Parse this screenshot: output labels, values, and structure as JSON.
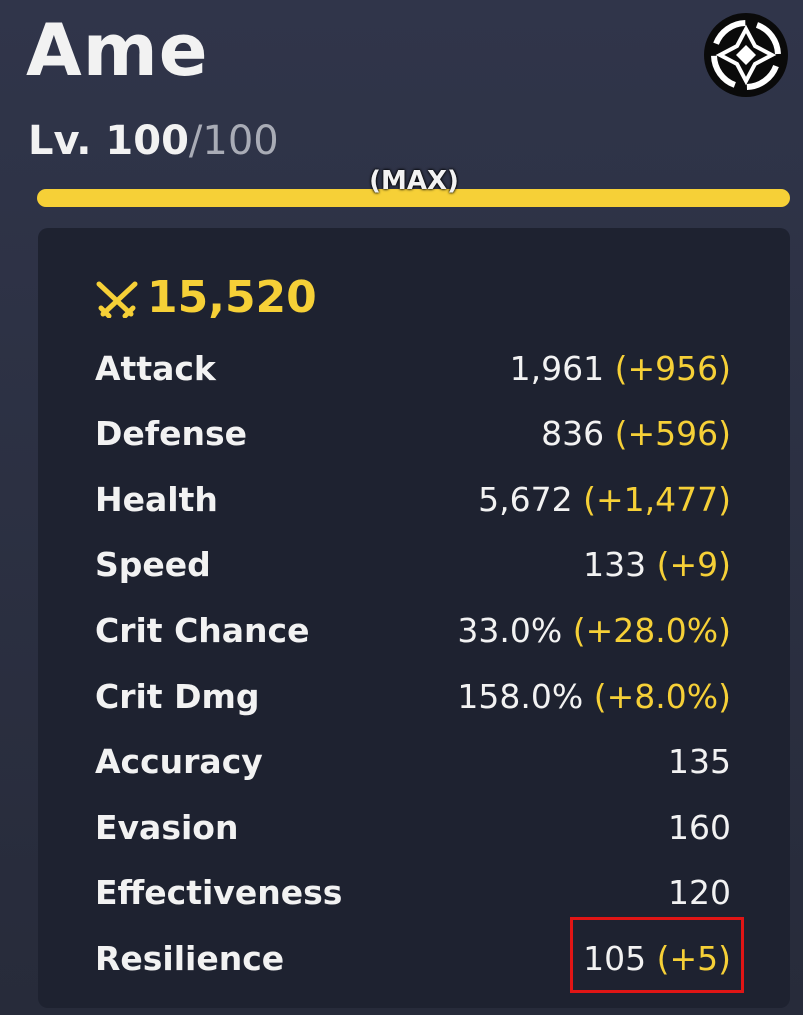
{
  "character": {
    "name": "Ame",
    "level_prefix": "Lv. ",
    "level": "100",
    "max_level": "/100",
    "level_progress": 1.0,
    "max_label": "(MAX)"
  },
  "power": {
    "icon": "crossed-swords-icon",
    "value": "15,520"
  },
  "stats": [
    {
      "label": "Attack",
      "value": "1,961",
      "bonus": "(+956)"
    },
    {
      "label": "Defense",
      "value": "836",
      "bonus": "(+596)"
    },
    {
      "label": "Health",
      "value": "5,672",
      "bonus": "(+1,477)"
    },
    {
      "label": "Speed",
      "value": "133",
      "bonus": "(+9)"
    },
    {
      "label": "Crit Chance",
      "value": "33.0%",
      "bonus": "(+28.0%)"
    },
    {
      "label": "Crit Dmg",
      "value": "158.0%",
      "bonus": "(+8.0%)"
    },
    {
      "label": "Accuracy",
      "value": "135",
      "bonus": ""
    },
    {
      "label": "Evasion",
      "value": "160",
      "bonus": ""
    },
    {
      "label": "Effectiveness",
      "value": "120",
      "bonus": ""
    },
    {
      "label": "Resilience",
      "value": "105",
      "bonus": "(+5)"
    }
  ],
  "colors": {
    "accent": "#f6d037",
    "highlight_box": "#e01515"
  }
}
